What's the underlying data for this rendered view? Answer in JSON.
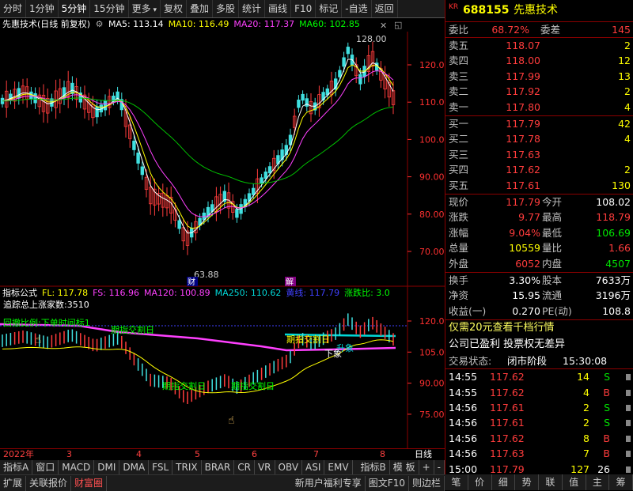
{
  "toolbar": {
    "items": [
      "分时",
      "1分钟",
      "5分钟",
      "15分钟",
      "更多",
      "复权",
      "叠加",
      "多股",
      "统计",
      "画线",
      "F10",
      "标记",
      "-自选",
      "返回"
    ],
    "dropdown_icon": "chevron-down-icon"
  },
  "chart": {
    "stock_title": "先惠技术(日线 前复权)",
    "ma": [
      {
        "label": "MA5: 113.14",
        "color": "#ffffff"
      },
      {
        "label": "MA10: 116.49",
        "color": "#ffff00"
      },
      {
        "label": "MA20: 117.37",
        "color": "#ff40ff"
      },
      {
        "label": "MA60: 102.85",
        "color": "#00ff00"
      }
    ],
    "y_ticks": [
      "120.0",
      "110.0",
      "100.0",
      "90.00",
      "80.00",
      "70.00"
    ],
    "high_label": "128.00",
    "low_label": "63.88",
    "marker_cai": "财",
    "marker_jie": "解"
  },
  "indicator": {
    "header": [
      {
        "label": "指标公式",
        "color": "#ffffff"
      },
      {
        "label": "FL: 117.78",
        "color": "#ffff00"
      },
      {
        "label": "FS: 116.96",
        "color": "#ff40ff"
      },
      {
        "label": "MA120: 100.89",
        "color": "#ff40ff"
      },
      {
        "label": "MA250: 110.62",
        "color": "#00d8d8"
      },
      {
        "label": "黄线: 117.79",
        "color": "#4040ff"
      },
      {
        "label": "涨跌比: 3.0",
        "color": "#00ff00"
      }
    ],
    "y_ticks": [
      "120.0",
      "105.0",
      "90.00",
      "75.00"
    ],
    "notes": {
      "n1": "追踪总上涨家数:3510",
      "n2": "回撤比例:下单时间标1",
      "n3": "期指交割日",
      "n4": "期指交割日",
      "n5": "期指交割日",
      "n6": "期指交割日",
      "n7": "升象",
      "n8": "下象"
    }
  },
  "xaxis": {
    "labels": [
      "2022年",
      "3",
      "4",
      "5",
      "6",
      "7",
      "8",
      "日线"
    ]
  },
  "tabs1": [
    "指标A",
    "窗口",
    "MACD",
    "DMI",
    "DMA",
    "FSL",
    "TRIX",
    "BRAR",
    "CR",
    "VR",
    "OBV",
    "ASI",
    "EMV",
    "指标B",
    "模 板",
    "+",
    "-"
  ],
  "tabs2": [
    "扩展",
    "关联报价",
    "财富圈",
    "新用户福利专享",
    "图文F10",
    "则边栏"
  ],
  "quote": {
    "code": "688155",
    "name": "先惠技术",
    "kr": "KR",
    "weibi_label": "委比",
    "weibi": "68.72%",
    "weicha_label": "委差",
    "weicha": "145",
    "asks": [
      {
        "label": "卖五",
        "price": "118.07",
        "vol": "2"
      },
      {
        "label": "卖四",
        "price": "118.00",
        "vol": "12"
      },
      {
        "label": "卖三",
        "price": "117.99",
        "vol": "13"
      },
      {
        "label": "卖二",
        "price": "117.92",
        "vol": "2"
      },
      {
        "label": "卖一",
        "price": "117.80",
        "vol": "4"
      }
    ],
    "bids": [
      {
        "label": "买一",
        "price": "117.79",
        "vol": "42"
      },
      {
        "label": "买二",
        "price": "117.78",
        "vol": "4"
      },
      {
        "label": "买三",
        "price": "117.63",
        "vol": ""
      },
      {
        "label": "买四",
        "price": "117.62",
        "vol": "2"
      },
      {
        "label": "买五",
        "price": "117.61",
        "vol": "130"
      }
    ],
    "stats": [
      {
        "l1": "现价",
        "v1": "117.79",
        "c1": "red",
        "l2": "今开",
        "v2": "108.02",
        "c2": "wht"
      },
      {
        "l1": "涨跌",
        "v1": "9.77",
        "c1": "red",
        "l2": "最高",
        "v2": "118.79",
        "c2": "red"
      },
      {
        "l1": "涨幅",
        "v1": "9.04%",
        "c1": "red",
        "l2": "最低",
        "v2": "106.69",
        "c2": "green"
      },
      {
        "l1": "总量",
        "v1": "10559",
        "c1": "yel",
        "l2": "量比",
        "v2": "1.66",
        "c2": "red"
      },
      {
        "l1": "外盘",
        "v1": "6052",
        "c1": "red",
        "l2": "内盘",
        "v2": "4507",
        "c2": "green"
      }
    ],
    "stats2": [
      {
        "l1": "换手",
        "v1": "3.30%",
        "l2": "股本",
        "v2": "7633万"
      },
      {
        "l1": "净资",
        "v1": "15.95",
        "l2": "流通",
        "v2": "3196万"
      },
      {
        "l1": "收益(一)",
        "v1": "0.270",
        "l2": "PE(动)",
        "v2": "108.8"
      }
    ],
    "promo": "仅需20元查看千档行情",
    "info": "公司已盈利 投票权无差异",
    "status_label": "交易状态:",
    "status": "闭市阶段",
    "status_time": "15:30:08",
    "ticks": [
      {
        "t": "14:55",
        "p": "117.62",
        "v": "14",
        "d": "S"
      },
      {
        "t": "14:55",
        "p": "117.62",
        "v": "4",
        "d": "B"
      },
      {
        "t": "14:56",
        "p": "117.61",
        "v": "2",
        "d": "S"
      },
      {
        "t": "14:56",
        "p": "117.61",
        "v": "2",
        "d": "S"
      },
      {
        "t": "14:56",
        "p": "117.62",
        "v": "8",
        "d": "B"
      },
      {
        "t": "14:56",
        "p": "117.63",
        "v": "7",
        "d": "B"
      },
      {
        "t": "15:00",
        "p": "117.79",
        "v": "127",
        "d": "26"
      }
    ]
  },
  "rtabs": [
    "笔",
    "价",
    "细",
    "势",
    "联",
    "值",
    "主",
    "筹"
  ]
}
